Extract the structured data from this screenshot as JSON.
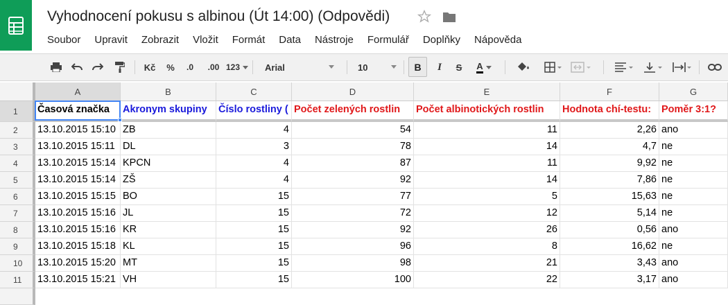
{
  "app": {
    "title": "Vyhodnocení pokusu s albinou (Út 14:00) (Odpovědi)",
    "brand_color": "#0f9d58",
    "star_icon": "star-icon",
    "folder_icon": "folder-icon"
  },
  "menu": [
    "Soubor",
    "Upravit",
    "Zobrazit",
    "Vložit",
    "Formát",
    "Data",
    "Nástroje",
    "Formulář",
    "Doplňky",
    "Nápověda"
  ],
  "toolbar": {
    "currency": "Kč",
    "percent": "%",
    "dec_less": ".0",
    "dec_more": ".00",
    "number_format": "123",
    "font": "Arial",
    "font_size": "10",
    "bold": "B",
    "italic": "I",
    "strike": "S",
    "text_color": "A"
  },
  "columns": [
    "A",
    "B",
    "C",
    "D",
    "E",
    "F",
    "G"
  ],
  "header_row": {
    "row_number": "1",
    "cells": [
      {
        "text": "Časová značka",
        "color": "#000000"
      },
      {
        "text": "Akronym skupiny",
        "color": "#1a1adb"
      },
      {
        "text": "Číslo rostliny (",
        "color": "#1a1adb"
      },
      {
        "text": "Počet zelených rostlin",
        "color": "#e0181a"
      },
      {
        "text": "Počet albinotických rostlin",
        "color": "#e0181a"
      },
      {
        "text": "Hodnota chí-testu:",
        "color": "#e0181a"
      },
      {
        "text": "Poměr 3:1?",
        "color": "#e0181a"
      }
    ]
  },
  "rows": [
    {
      "n": "2",
      "cells": [
        "13.10.2015 15:10",
        "ZB",
        "4",
        "54",
        "11",
        "2,26",
        "ano"
      ]
    },
    {
      "n": "3",
      "cells": [
        "13.10.2015 15:11",
        "DL",
        "3",
        "78",
        "14",
        "4,7",
        "ne"
      ]
    },
    {
      "n": "4",
      "cells": [
        "13.10.2015 15:14",
        "KPCN",
        "4",
        "87",
        "11",
        "9,92",
        "ne"
      ]
    },
    {
      "n": "5",
      "cells": [
        "13.10.2015 15:14",
        "ZŠ",
        "4",
        "92",
        "14",
        "7,86",
        "ne"
      ]
    },
    {
      "n": "6",
      "cells": [
        "13.10.2015 15:15",
        "BO",
        "15",
        "77",
        "5",
        "15,63",
        "ne"
      ]
    },
    {
      "n": "7",
      "cells": [
        "13.10.2015 15:16",
        "JL",
        "15",
        "72",
        "12",
        "5,14",
        "ne"
      ]
    },
    {
      "n": "8",
      "cells": [
        "13.10.2015 15:16",
        "KR",
        "15",
        "92",
        "26",
        "0,56",
        "ano"
      ]
    },
    {
      "n": "9",
      "cells": [
        "13.10.2015 15:18",
        "KL",
        "15",
        "96",
        "8",
        "16,62",
        "ne"
      ]
    },
    {
      "n": "10",
      "cells": [
        "13.10.2015 15:20",
        "MT",
        "15",
        "98",
        "21",
        "3,43",
        "ano"
      ]
    },
    {
      "n": "11",
      "cells": [
        "13.10.2015 15:21",
        "VH",
        "15",
        "100",
        "22",
        "3,17",
        "ano"
      ]
    }
  ],
  "numeric_columns": [
    2,
    3,
    4,
    5
  ]
}
